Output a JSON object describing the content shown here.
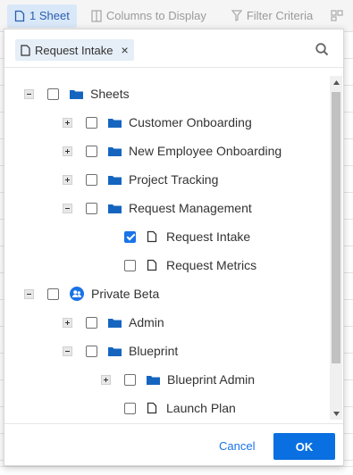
{
  "toolbar": {
    "items": [
      {
        "label": "1 Sheet",
        "icon": "sheet-icon"
      },
      {
        "label": "Columns to Display",
        "icon": "columns-icon"
      },
      {
        "label": "Filter Criteria",
        "icon": "filter-icon"
      }
    ]
  },
  "chip": {
    "label": "Request Intake",
    "remove": "×"
  },
  "tree": {
    "rows": [
      {
        "label": "Sheets",
        "toggle": "minus",
        "checked": false,
        "icon": "folder-icon"
      },
      {
        "label": "Customer Onboarding",
        "toggle": "plus",
        "checked": false,
        "icon": "folder-icon"
      },
      {
        "label": "New Employee Onboarding",
        "toggle": "plus",
        "checked": false,
        "icon": "folder-icon"
      },
      {
        "label": "Project Tracking",
        "toggle": "plus",
        "checked": false,
        "icon": "folder-icon"
      },
      {
        "label": "Request Management",
        "toggle": "minus",
        "checked": false,
        "icon": "folder-icon"
      },
      {
        "label": "Request Intake",
        "toggle": "none",
        "checked": true,
        "icon": "sheet-icon"
      },
      {
        "label": "Request Metrics",
        "toggle": "none",
        "checked": false,
        "icon": "sheet-icon"
      },
      {
        "label": "Private Beta",
        "toggle": "minus",
        "checked": false,
        "icon": "workspace-icon"
      },
      {
        "label": "Admin",
        "toggle": "plus",
        "checked": false,
        "icon": "folder-icon"
      },
      {
        "label": "Blueprint",
        "toggle": "minus",
        "checked": false,
        "icon": "folder-icon"
      },
      {
        "label": "Blueprint Admin",
        "toggle": "plus",
        "checked": false,
        "icon": "folder-icon"
      },
      {
        "label": "Launch Plan",
        "toggle": "none",
        "checked": false,
        "icon": "sheet-icon"
      }
    ]
  },
  "footer": {
    "cancel_label": "Cancel",
    "ok_label": "OK"
  },
  "colors": {
    "accent": "#0a6fe0",
    "folder": "#1565c0",
    "workspace": "#1a73e8"
  }
}
